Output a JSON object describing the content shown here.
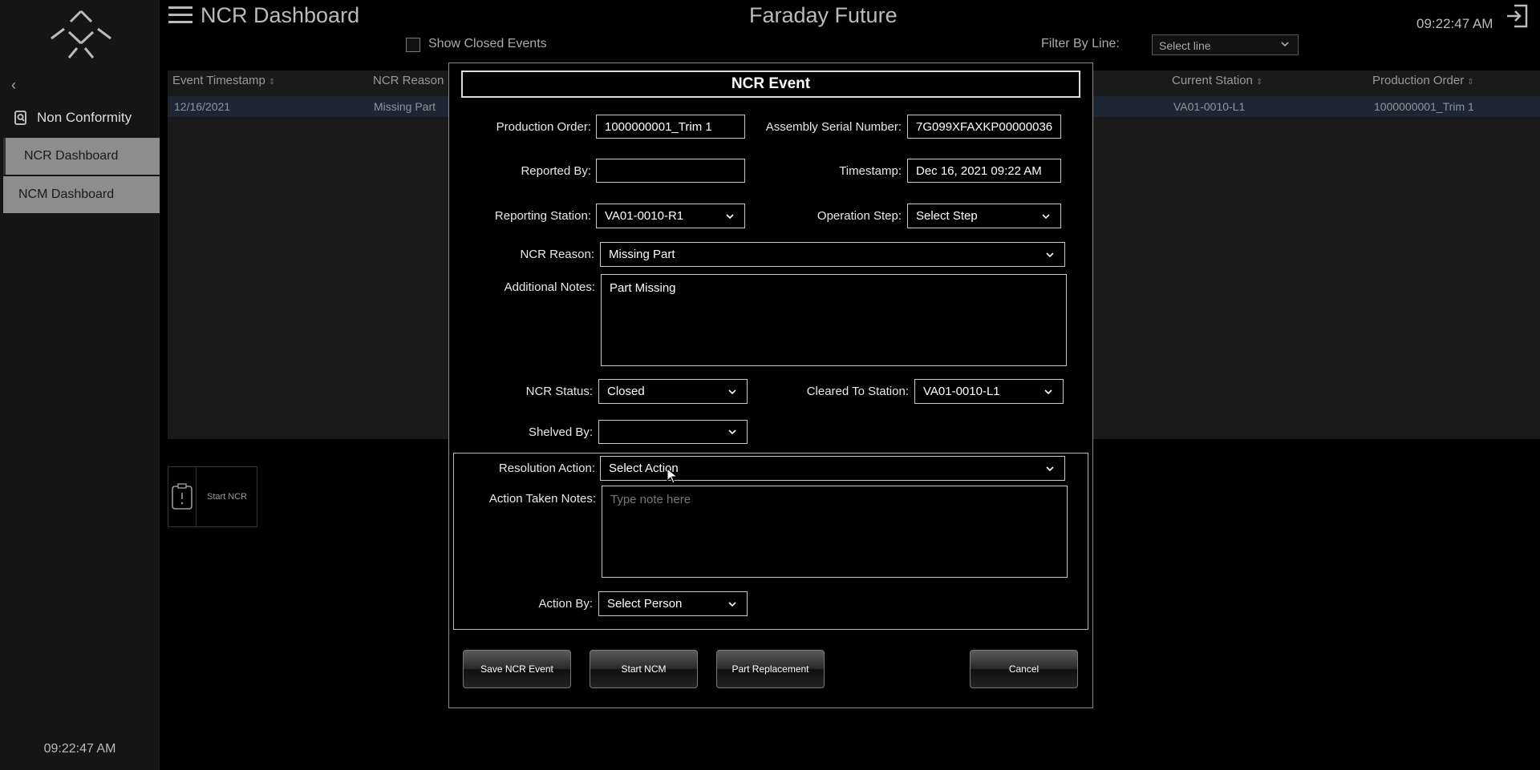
{
  "sidebar": {
    "section_title": "Non Conformity",
    "items": [
      {
        "label": "NCR Dashboard"
      },
      {
        "label": "NCM Dashboard"
      }
    ],
    "clock": "09:22:47 AM"
  },
  "header": {
    "page_title": "NCR Dashboard",
    "brand": "Faraday Future",
    "clock": "09:22:47 AM"
  },
  "toolbar": {
    "show_closed_label": "Show Closed Events",
    "show_closed_checked": false,
    "filter_label": "Filter By Line:",
    "filter_value": "Select line"
  },
  "table": {
    "columns": [
      "Event Timestamp",
      "NCR Reason",
      "Current Station",
      "Production Order"
    ],
    "rows": [
      {
        "event_timestamp": "12/16/2021",
        "ncr_reason": "Missing Part",
        "current_station": "VA01-0010-L1",
        "production_order": "1000000001_Trim 1"
      }
    ]
  },
  "start_ncr_label": "Start NCR",
  "modal": {
    "title": "NCR Event",
    "production_order_label": "Production Order:",
    "production_order": "1000000001_Trim 1",
    "serial_label": "Assembly Serial Number:",
    "serial": "7G099XFAXKP00000036",
    "reported_by_label": "Reported By:",
    "reported_by": "",
    "timestamp_label": "Timestamp:",
    "timestamp": "Dec 16, 2021 09:22 AM",
    "reporting_station_label": "Reporting Station:",
    "reporting_station": "VA01-0010-R1",
    "operation_step_label": "Operation Step:",
    "operation_step": "Select Step",
    "ncr_reason_label": "NCR Reason:",
    "ncr_reason": "Missing Part",
    "notes_label": "Additional Notes:",
    "notes": "Part Missing",
    "status_label": "NCR Status:",
    "status": "Closed",
    "cleared_label": "Cleared To Station:",
    "cleared": "VA01-0010-L1",
    "shelved_label": "Shelved By:",
    "shelved": "",
    "resolution_label": "Resolution Action:",
    "resolution": "Select Action",
    "action_notes_label": "Action Taken Notes:",
    "action_notes_placeholder": "Type note here",
    "action_by_label": "Action By:",
    "action_by": "Select Person",
    "buttons": {
      "save": "Save NCR Event",
      "start_ncm": "Start NCM",
      "part_replacement": "Part Replacement",
      "cancel": "Cancel"
    }
  },
  "colors": {
    "background": "#000000",
    "sidebar": "#151515",
    "nav_active": "#8d8d8d",
    "table_row": "#1c2733"
  }
}
